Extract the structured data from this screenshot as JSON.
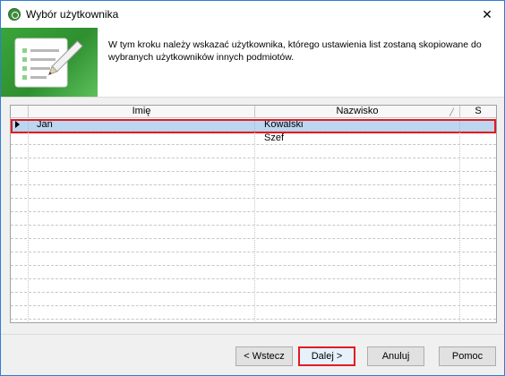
{
  "window": {
    "title": "Wybór użytkownika",
    "close_glyph": "✕"
  },
  "header": {
    "description": "W tym kroku należy wskazać użytkownika, którego ustawienia list zostaną skopiowane do wybranych użytkowników innych podmiotów.",
    "banner_icon": "notepad-pencil-icon"
  },
  "grid": {
    "columns": [
      "",
      "Imię",
      "Nazwisko",
      "S"
    ],
    "rows": [
      {
        "imie": "Jan",
        "nazwisko": "Kowalski",
        "s": "",
        "selected": true
      },
      {
        "imie": "",
        "nazwisko": "Szef",
        "s": "",
        "selected": false
      }
    ],
    "empty_rows": 14
  },
  "buttons": {
    "back": "< Wstecz",
    "next": "Dalej >",
    "cancel": "Anuluj",
    "help": "Pomoc"
  },
  "colors": {
    "selection": "#bcd6f0",
    "highlight": "#e01b24",
    "banner": "#3aa53a"
  }
}
